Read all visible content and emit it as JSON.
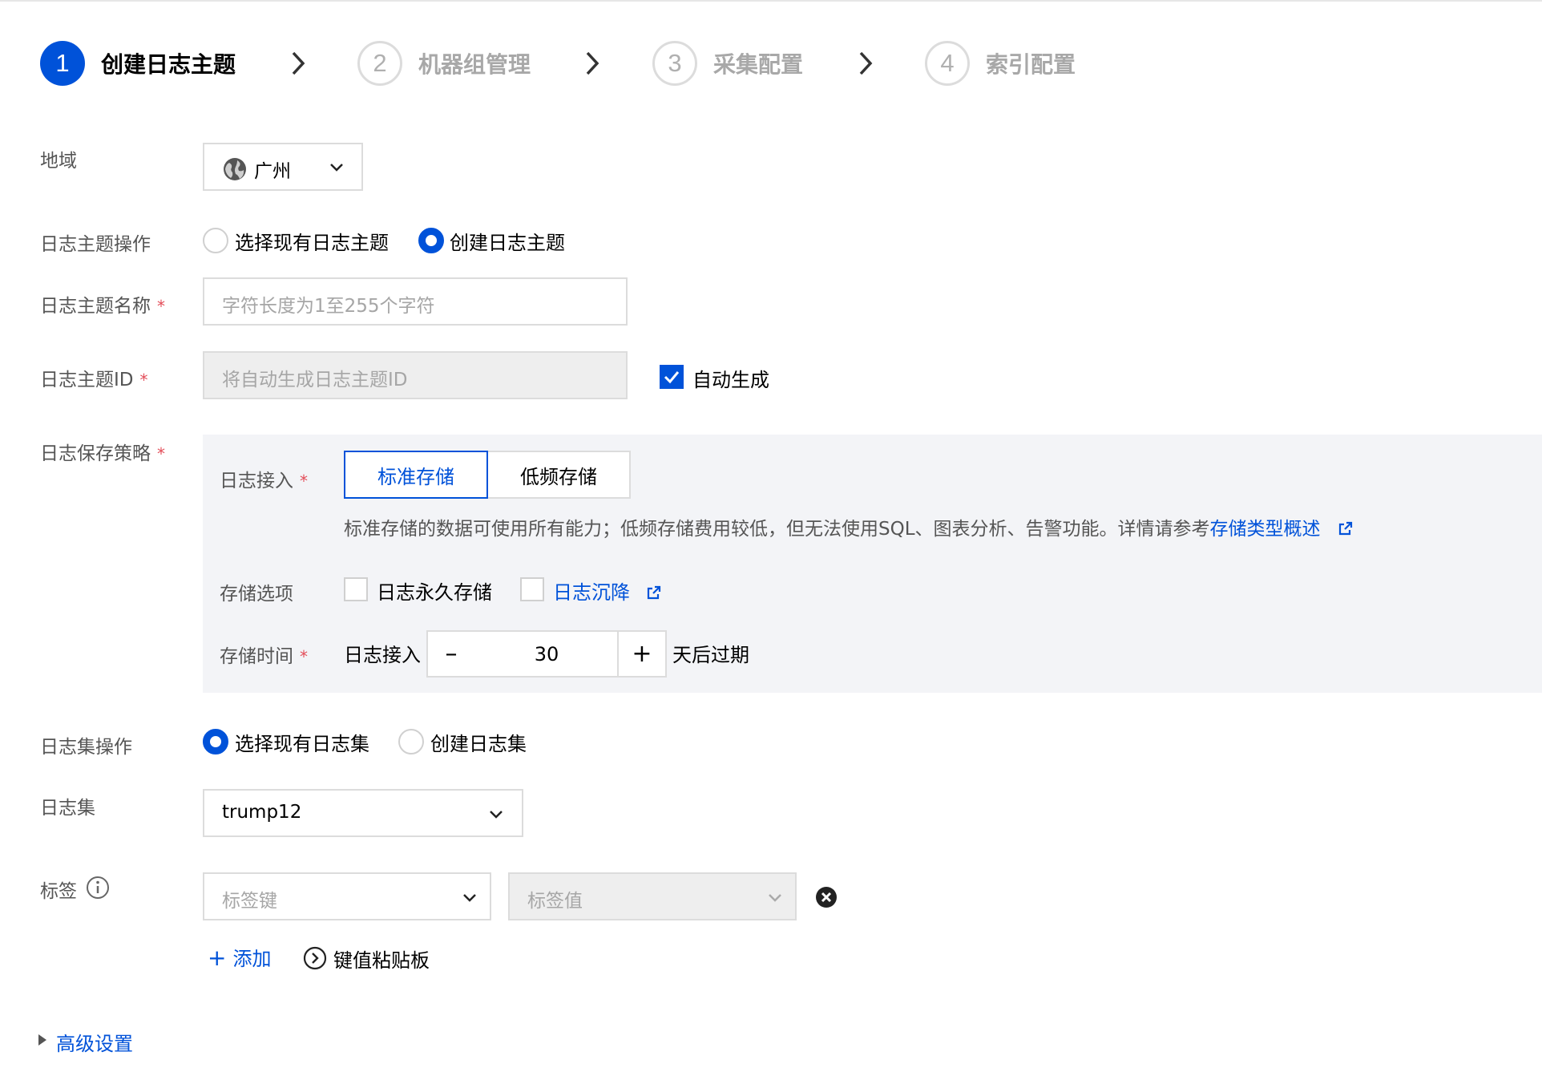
{
  "steps": [
    {
      "num": "1",
      "label": "创建日志主题"
    },
    {
      "num": "2",
      "label": "机器组管理"
    },
    {
      "num": "3",
      "label": "采集配置"
    },
    {
      "num": "4",
      "label": "索引配置"
    }
  ],
  "region": {
    "label": "地域",
    "value": "广州"
  },
  "topic_op": {
    "label": "日志主题操作",
    "options": [
      "选择现有日志主题",
      "创建日志主题"
    ],
    "selected": 1
  },
  "topic_name": {
    "label": "日志主题名称",
    "placeholder": "字符长度为1至255个字符"
  },
  "topic_id": {
    "label": "日志主题ID",
    "placeholder": "将自动生成日志主题ID",
    "auto_label": "自动生成",
    "auto_checked": true
  },
  "retention": {
    "label": "日志保存策略",
    "ingest_label": "日志接入",
    "types": [
      "标准存储",
      "低频存储"
    ],
    "selected": 0,
    "desc": "标准存储的数据可使用所有能力；低频存储费用较低，但无法使用SQL、图表分析、告警功能。详情请参考",
    "desc_link": "存储类型概述",
    "options_label": "存储选项",
    "permanent_label": "日志永久存储",
    "sink_label": "日志沉降",
    "time_label": "存储时间",
    "time_prefix": "日志接入",
    "days": "30",
    "time_suffix": "天后过期",
    "minus": "–",
    "plus": "+"
  },
  "logset_op": {
    "label": "日志集操作",
    "options": [
      "选择现有日志集",
      "创建日志集"
    ],
    "selected": 0
  },
  "logset": {
    "label": "日志集",
    "value": "trump12"
  },
  "tags": {
    "label": "标签",
    "key_placeholder": "标签键",
    "value_placeholder": "标签值",
    "add_label": "添加",
    "add_symbol": "+",
    "paste_label": "键值粘贴板"
  },
  "advanced": {
    "label": "高级设置"
  },
  "colors": {
    "primary": "#0052d9",
    "required": "#e34d59"
  }
}
